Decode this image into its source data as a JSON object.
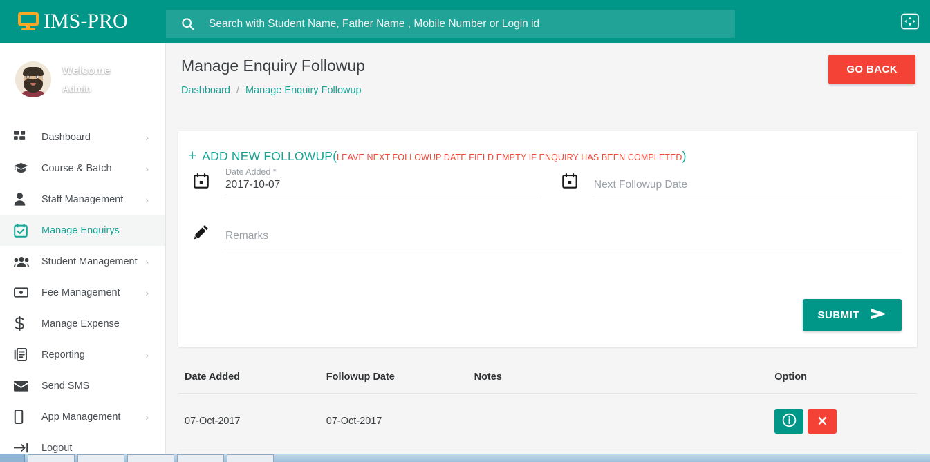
{
  "topbar": {
    "brand": "IMS-PRO",
    "brand_icon": "monitor-icon",
    "search_icon": "search-icon",
    "search_placeholder": "Search with Student Name, Father Name , Mobile Number or Login id",
    "search_value": "",
    "fullscreen_icon": "fullscreen-icon",
    "bg_color": "#009688",
    "brand_icon_color": "#f9a825"
  },
  "profile": {
    "avatar_name": "user-avatar",
    "welcome": "Welcome",
    "role": "Admin",
    "caret_icon": "chevron-down-icon"
  },
  "sidebar": {
    "items": [
      {
        "label": "Dashboard",
        "icon": "dashboard-grid-icon",
        "chevron": "›",
        "active": false
      },
      {
        "label": "Course & Batch",
        "icon": "graduation-cap-icon",
        "chevron": "›",
        "active": false
      },
      {
        "label": "Staff Management",
        "icon": "person-icon",
        "chevron": "›",
        "active": false
      },
      {
        "label": "Manage Enquirys",
        "icon": "calendar-check-icon",
        "chevron": "",
        "active": true
      },
      {
        "label": "Student Management",
        "icon": "people-group-icon",
        "chevron": "›",
        "active": false
      },
      {
        "label": "Fee Management",
        "icon": "banknote-icon",
        "chevron": "›",
        "active": false
      },
      {
        "label": "Manage Expense",
        "icon": "dollar-sign-icon",
        "chevron": "",
        "active": false
      },
      {
        "label": "Reporting",
        "icon": "report-book-icon",
        "chevron": "›",
        "active": false
      },
      {
        "label": "Send SMS",
        "icon": "envelope-icon",
        "chevron": "",
        "active": false
      },
      {
        "label": "App Management",
        "icon": "mobile-phone-icon",
        "chevron": "›",
        "active": false
      },
      {
        "label": "Logout",
        "icon": "logout-arrow-icon",
        "chevron": "",
        "active": false
      }
    ],
    "active_color": "#16a595"
  },
  "page": {
    "title": "Manage Enquiry Followup",
    "breadcrumb_home": "Dashboard",
    "breadcrumb_sep": "/",
    "breadcrumb_current": "Manage Enquiry Followup",
    "go_back_label": "GO BACK",
    "go_back_color": "#f44336"
  },
  "form": {
    "plus_icon": "plus-icon",
    "add_new_label": "ADD NEW FOLLOWUP",
    "paren_open": "(",
    "hint": "LEAVE NEXT FOLLOWUP DATE FIELD EMPTY IF ENQUIRY HAS BEEN COMPLETED",
    "paren_close": ")",
    "date_added_label": "Date Added *",
    "date_added_value": "2017-10-07",
    "date_added_icon": "calendar-icon",
    "next_followup_placeholder": "Next Followup Date",
    "next_followup_value": "",
    "next_followup_icon": "calendar-icon",
    "remarks_placeholder": "Remarks",
    "remarks_value": "",
    "remarks_icon": "pencil-icon",
    "submit_label": "SUBMIT",
    "submit_icon": "send-arrow-icon",
    "submit_color": "#009688"
  },
  "table": {
    "headers": {
      "date_added": "Date Added",
      "followup_date": "Followup Date",
      "notes": "Notes",
      "option": "Option"
    },
    "rows": [
      {
        "date_added": "07-Oct-2017",
        "followup_date": "07-Oct-2017",
        "notes": "",
        "info_icon": "info-circle-icon",
        "delete_icon": "close-x-icon",
        "delete_label": "✕"
      }
    ]
  }
}
